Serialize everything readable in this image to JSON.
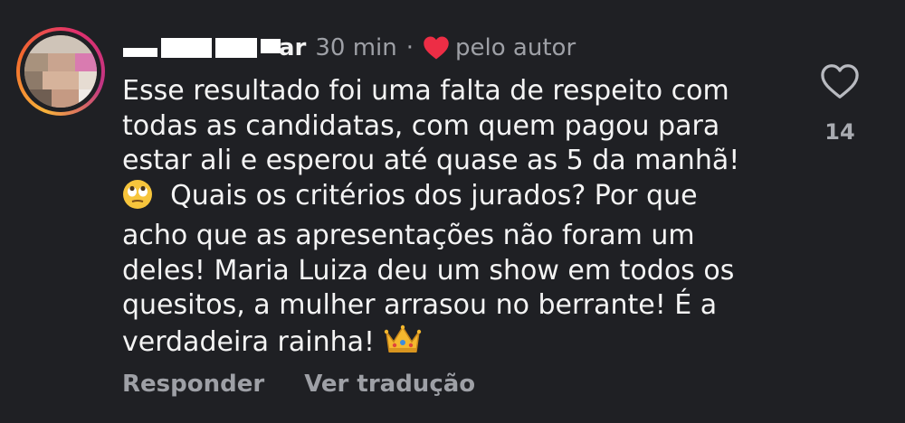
{
  "comment": {
    "username_visible": "ar",
    "time": "30 min",
    "separator": "·",
    "liked_by_author_label": "pelo autor",
    "lines": [
      "Esse resultado foi uma falta de respeito com",
      "todas as candidatas, com quem pagou para",
      "estar ali e esperou até quase as 5 da manhã!",
      "Quais os critérios dos jurados? Por que",
      "acho que as apresentações não foram um",
      "deles! Maria Luiza deu um show em todos os",
      "quesitos, a mulher arrasou no berrante! É a",
      "verdadeira rainha!"
    ],
    "emojis": {
      "line4_prefix": "eye-roll-emoji",
      "line8_suffix": "crown-emoji"
    },
    "like_count": "14",
    "actions": {
      "reply": "Responder",
      "translate": "Ver tradução"
    }
  },
  "colors": {
    "background": "#1f2024",
    "text": "#f4f4f4",
    "muted": "#9ea0a6",
    "heart_red": "#ed2d45"
  }
}
